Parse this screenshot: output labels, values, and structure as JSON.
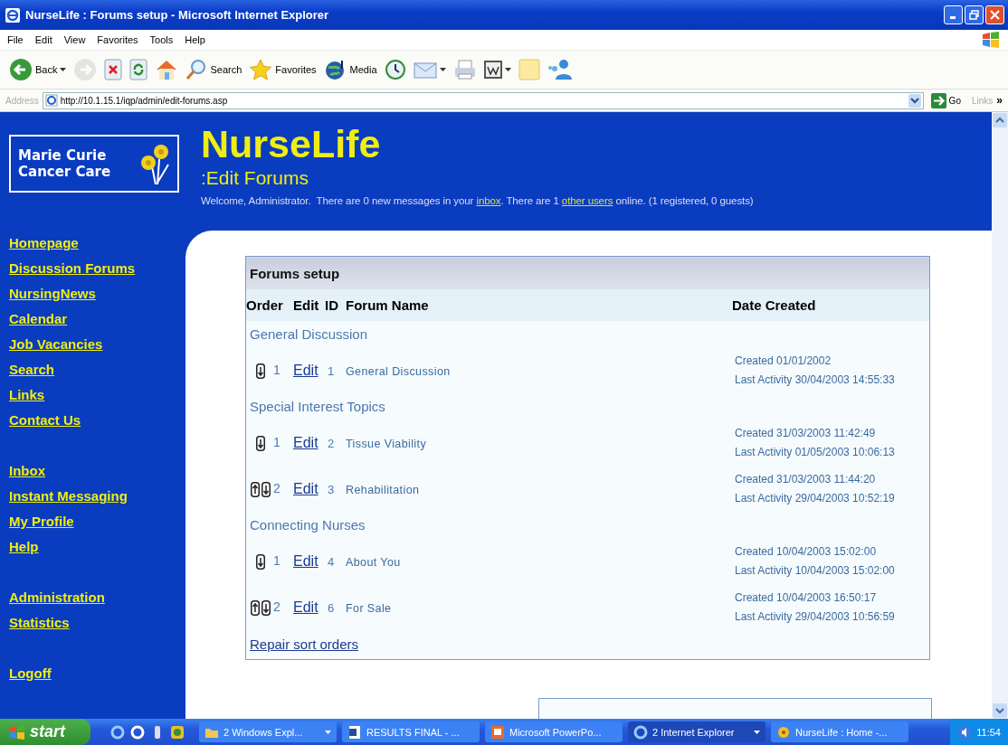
{
  "window": {
    "title": "NurseLife : Forums setup - Microsoft Internet Explorer"
  },
  "menu": [
    "File",
    "Edit",
    "View",
    "Favorites",
    "Tools",
    "Help"
  ],
  "toolbar": [
    {
      "kind": "back",
      "label": "Back",
      "caret": true,
      "disabled": false
    },
    {
      "kind": "forward",
      "caret": false,
      "disabled": true
    },
    {
      "kind": "stop",
      "caret": false,
      "disabled": false
    },
    {
      "kind": "refresh",
      "caret": false,
      "disabled": false
    },
    {
      "kind": "home",
      "caret": false,
      "disabled": false
    },
    {
      "kind": "search",
      "label": "Search",
      "caret": false,
      "disabled": false
    },
    {
      "kind": "favorites",
      "label": "Favorites",
      "caret": false,
      "disabled": false
    },
    {
      "kind": "media",
      "label": "Media",
      "caret": false,
      "disabled": false
    },
    {
      "kind": "history",
      "caret": false,
      "disabled": false
    },
    {
      "kind": "mail",
      "caret": true,
      "disabled": false
    },
    {
      "kind": "print",
      "caret": false,
      "disabled": false
    },
    {
      "kind": "edit",
      "caret": true,
      "disabled": false
    },
    {
      "kind": "note",
      "caret": false,
      "disabled": false
    },
    {
      "kind": "messenger",
      "caret": false,
      "disabled": false
    }
  ],
  "address": {
    "label": "Address",
    "value": "http://10.1.15.1/iqp/admin/edit-forums.asp",
    "go": "Go",
    "links": "Links",
    "more": "»"
  },
  "logo": {
    "lines": [
      "Marie Curie",
      "Cancer Care"
    ]
  },
  "header": {
    "title": "NurseLife",
    "subtitle": ":Edit Forums",
    "welcome": [
      {
        "kind": "text",
        "text": "Welcome, Administrator.  There are 0 new messages in your "
      },
      {
        "kind": "link",
        "text": "inbox"
      },
      {
        "kind": "text",
        "text": ". There are 1 "
      },
      {
        "kind": "link",
        "text": "other users"
      },
      {
        "kind": "text",
        "text": " online. (1 registered, 0 guests)"
      }
    ]
  },
  "nav": [
    [
      "Homepage",
      "Discussion Forums",
      "NursingNews",
      "Calendar",
      "Job Vacancies",
      "Search",
      "Links",
      "Contact Us"
    ],
    [
      "Inbox",
      "Instant Messaging",
      "My Profile",
      "Help"
    ],
    [
      "Administration",
      "Statistics"
    ],
    [
      "Logoff"
    ]
  ],
  "table": {
    "title": "Forums setup",
    "columns": [
      "Order",
      "Edit",
      "ID",
      "Forum Name",
      "Date Created"
    ],
    "groups": [
      {
        "name": "General Discussion",
        "forums": [
          {
            "up": false,
            "down": true,
            "order": "1",
            "edit": "Edit",
            "id": "1",
            "name": "General Discussion",
            "created": "Created 01/01/2002",
            "activity": "Last Activity 30/04/2003 14:55:33"
          }
        ]
      },
      {
        "name": "Special Interest Topics",
        "forums": [
          {
            "up": false,
            "down": true,
            "order": "1",
            "edit": "Edit",
            "id": "2",
            "name": "Tissue Viability",
            "created": "Created 31/03/2003 11:42:49",
            "activity": "Last Activity 01/05/2003 10:06:13"
          },
          {
            "up": true,
            "down": true,
            "order": "2",
            "edit": "Edit",
            "id": "3",
            "name": "Rehabilitation",
            "created": "Created 31/03/2003 11:44:20",
            "activity": "Last Activity 29/04/2003 10:52:19"
          }
        ]
      },
      {
        "name": "Connecting Nurses",
        "forums": [
          {
            "up": false,
            "down": true,
            "order": "1",
            "edit": "Edit",
            "id": "4",
            "name": "About You",
            "created": "Created 10/04/2003 15:02:00",
            "activity": "Last Activity 10/04/2003 15:02:00"
          },
          {
            "up": true,
            "down": true,
            "order": "2",
            "edit": "Edit",
            "id": "6",
            "name": "For Sale",
            "created": "Created 10/04/2003 16:50:17",
            "activity": "Last Activity 29/04/2003 10:56:59"
          }
        ]
      }
    ],
    "footer_link": "Repair sort orders"
  },
  "taskbar": {
    "start": "start",
    "tasks": [
      {
        "kind": "folder",
        "label": "2 Windows Expl...",
        "caret": true,
        "selected": false
      },
      {
        "kind": "word",
        "label": "RESULTS FINAL - ...",
        "caret": false,
        "selected": false
      },
      {
        "kind": "powerpoint",
        "label": "Microsoft PowerPo...",
        "caret": false,
        "selected": false
      },
      {
        "kind": "ie",
        "label": "2 Internet Explorer",
        "caret": true,
        "selected": true
      },
      {
        "kind": "site",
        "label": "NurseLife : Home -...",
        "caret": false,
        "selected": false
      }
    ],
    "clock": "11:54"
  }
}
